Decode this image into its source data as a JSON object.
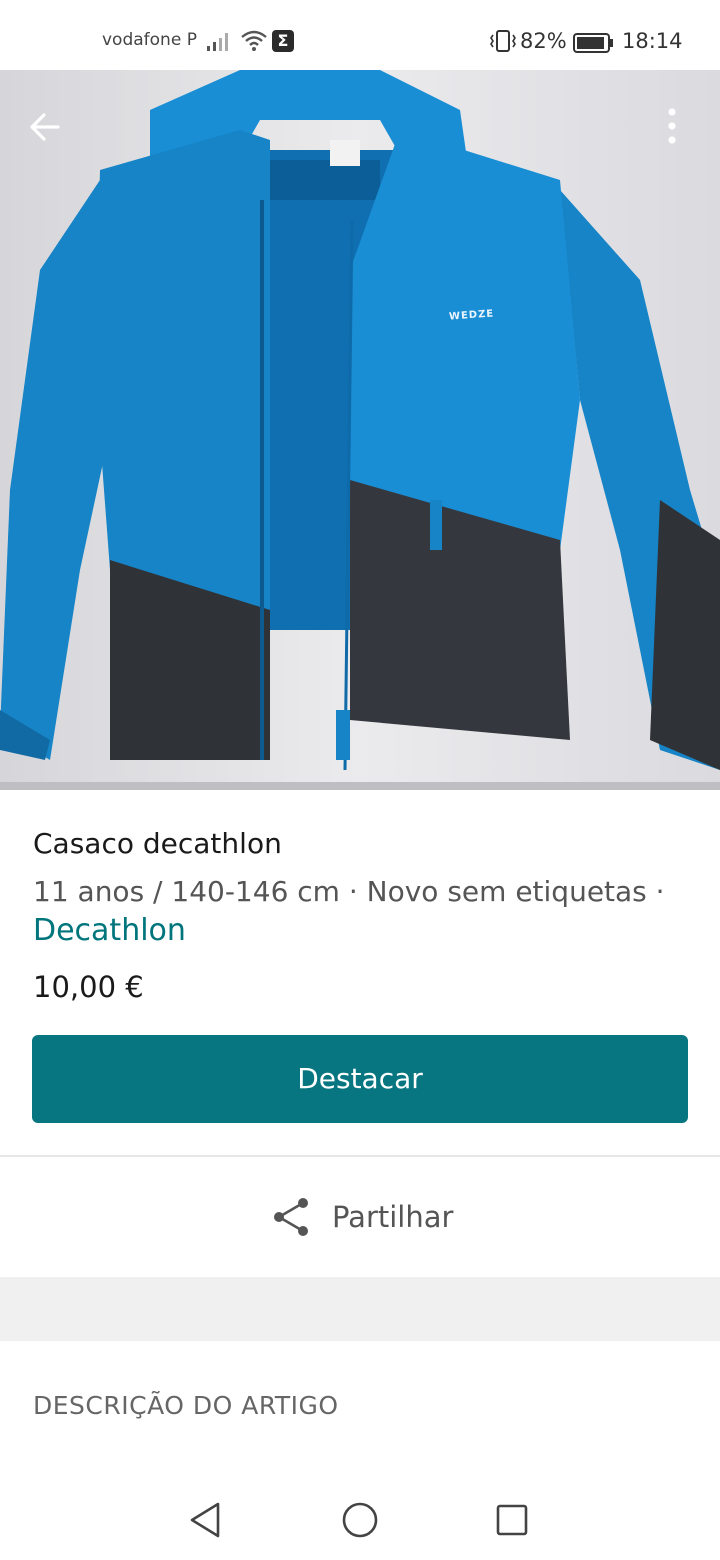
{
  "status_bar": {
    "carrier": "vodafone P",
    "battery_percent": "82%",
    "time": "18:14",
    "icons": [
      "signal-icon",
      "wifi-icon",
      "sigma-icon",
      "vibrate-icon",
      "battery-icon"
    ]
  },
  "photo": {
    "brand_tag": "WEDZE",
    "colors": {
      "jacket_blue": "#1684c6",
      "jacket_dark": "#2f3338",
      "wall": "#e2e2e4"
    }
  },
  "toolbar": {
    "back_icon": "back-arrow-icon",
    "more_icon": "more-vert-icon"
  },
  "item": {
    "title": "Casaco decathlon",
    "details": "11 anos / 140-146 cm · Novo sem etiquetas ·",
    "brand": "Decathlon",
    "price": "10,00 €"
  },
  "actions": {
    "promote_label": "Destacar",
    "share_label": "Partilhar",
    "share_icon": "share-icon"
  },
  "description": {
    "heading": "DESCRIÇÃO DO ARTIGO"
  },
  "nav": {
    "icons": [
      "back-triangle-icon",
      "home-circle-icon",
      "recents-square-icon"
    ]
  },
  "theme": {
    "accent": "#077680",
    "link": "#00757c"
  }
}
